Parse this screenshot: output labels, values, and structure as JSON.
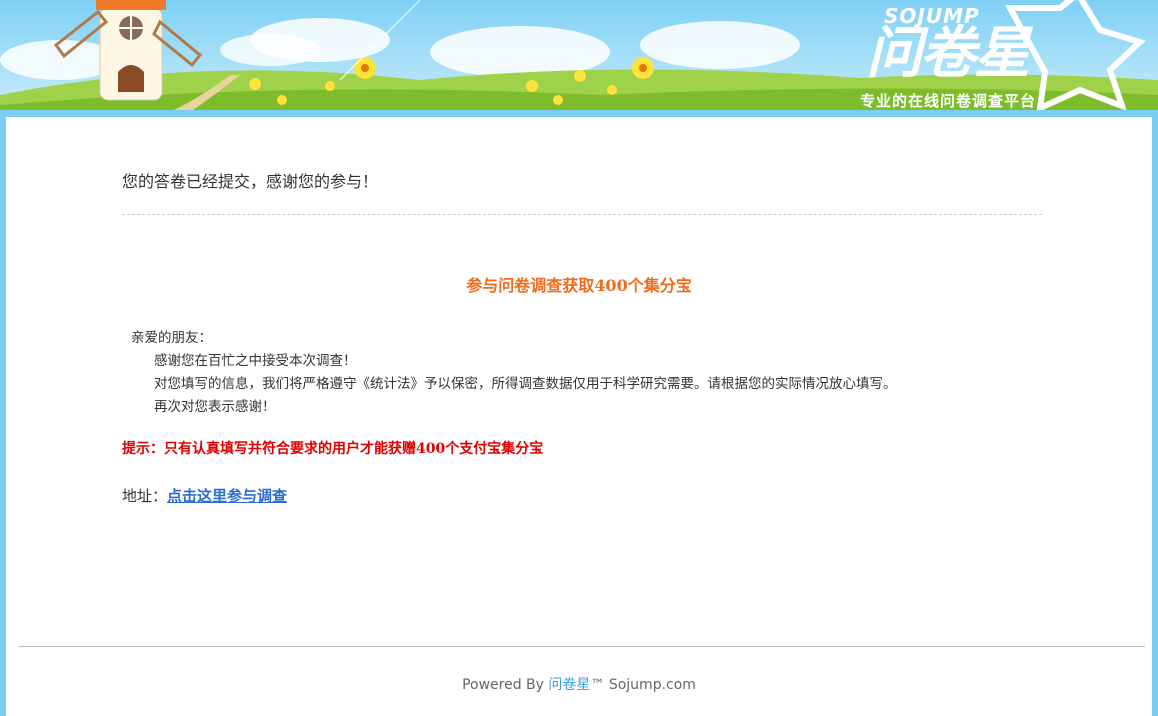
{
  "banner": {
    "logo_en": "SOJUMP",
    "logo_cn": "问卷星",
    "slogan": "专业的在线问卷调查平台"
  },
  "confirmation": {
    "message": "您的答卷已经提交，感谢您的参与！"
  },
  "promo": {
    "title": "参与问卷调查获取400个集分宝",
    "greeting": "亲爱的朋友：",
    "line1": "感谢您在百忙之中接受本次调查！",
    "line2": "对您填写的信息，我们将严格遵守《统计法》予以保密，所得调查数据仅用于科学研究需要。请根据您的实际情况放心填写。",
    "line3": "再次对您表示感谢！",
    "hint": "提示：只有认真填写并符合要求的用户才能获赠400个支付宝集分宝",
    "address_label": "地址：",
    "address_link": "点击这里参与调查"
  },
  "footer": {
    "powered_by": "Powered By",
    "brand": "问卷星",
    "suffix": "™ Sojump.com"
  },
  "colors": {
    "accent_orange": "#f26b1d",
    "hint_red": "#e00000",
    "link_blue": "#2b6ccf",
    "frame_blue": "#7ccdf3"
  }
}
